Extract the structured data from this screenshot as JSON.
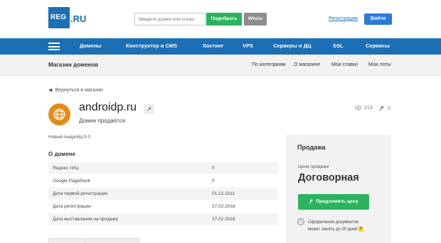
{
  "header": {
    "logo_text": "REG",
    "logo_suffix": ".RU",
    "search_placeholder": "Введите домен или слово",
    "pick_button": "Подобрать",
    "whois_button": "Whois",
    "register_link": "Регистрация",
    "login_button": "Войти"
  },
  "nav": {
    "items": [
      "Домены",
      "Конструктор и CMS",
      "Хостинг",
      "VPS",
      "Серверы и ДЦ",
      "SSL",
      "Сервисы"
    ]
  },
  "subheader": {
    "title": "Магазин доменов",
    "links": [
      "По категориям",
      "О магазине",
      "Мои ставки",
      "Мои лоты"
    ]
  },
  "back_link": "Вернуться в магазин",
  "domain": {
    "name": "androidp.ru",
    "status": "Домен продаётся",
    "views": "213",
    "bids": "0",
    "description": "Новый Андройд 9.0"
  },
  "about": {
    "title": "О домене",
    "rows": [
      {
        "label": "Яндекс тИЦ",
        "value": "0"
      },
      {
        "label": "Google PageRank",
        "value": "0"
      },
      {
        "label": "Дата первой регистрации",
        "value": "01.12.2011"
      },
      {
        "label": "Дата регистрации",
        "value": "27.02.2018"
      },
      {
        "label": "Дата выставления на продажу",
        "value": "27.02.2018"
      }
    ]
  },
  "sale": {
    "title": "Продажа",
    "price_label": "Цена продажи",
    "price_value": "Договорная",
    "offer_button": "Предложить цену",
    "note_line1": "Оформление документов",
    "note_line2": "может занять до 20 дней"
  },
  "colors": {
    "brand_blue": "#1a6fb5",
    "green": "#2bb35f",
    "orange_icon": "#e98a15"
  }
}
